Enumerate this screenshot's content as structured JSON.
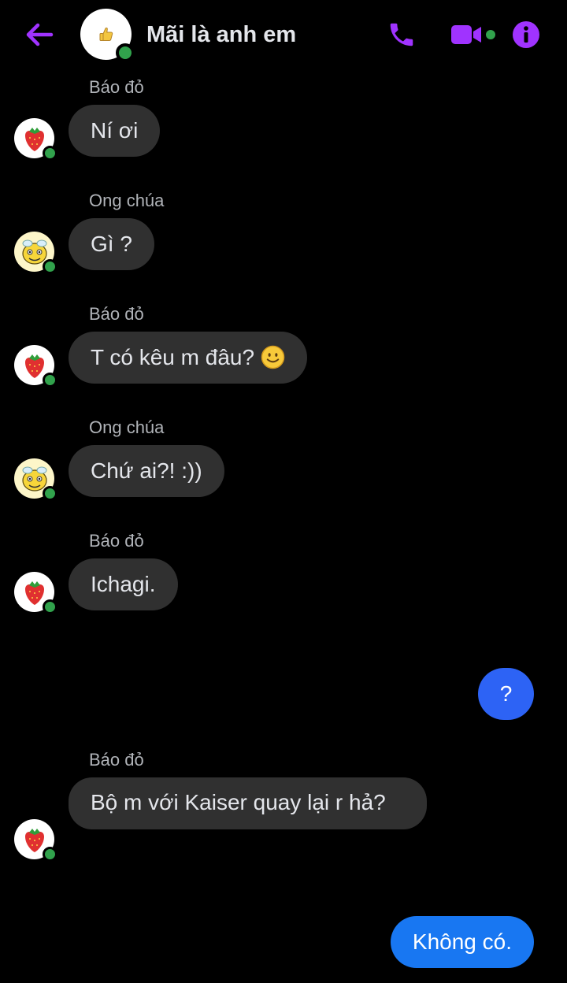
{
  "header": {
    "title": "Mãi là anh em",
    "back_icon": "arrow-left-icon",
    "call_icon": "phone-icon",
    "video_icon": "video-camera-icon",
    "info_icon": "info-icon",
    "accent_color": "#a033ff",
    "online_color": "#31a24c"
  },
  "messages": [
    {
      "sender": "Báo đỏ",
      "text": "Ní ơi",
      "avatar": "strawberry-icon",
      "direction": "incoming"
    },
    {
      "sender": "Ong chúa",
      "text": "Gì ?",
      "avatar": "bee-icon",
      "direction": "incoming"
    },
    {
      "sender": "Báo đỏ",
      "text": "T có kêu m đâu?",
      "emoji": "smile-emoji-icon",
      "avatar": "strawberry-icon",
      "direction": "incoming"
    },
    {
      "sender": "Ong chúa",
      "text": "Chứ ai?! :))",
      "avatar": "bee-icon",
      "direction": "incoming"
    },
    {
      "sender": "Báo đỏ",
      "text": "Ichagi.",
      "avatar": "strawberry-icon",
      "direction": "incoming"
    },
    {
      "text": "?",
      "direction": "outgoing"
    },
    {
      "sender": "Báo đỏ",
      "text": "Bộ m với Kaiser quay lại r hả?",
      "avatar": "strawberry-icon",
      "direction": "incoming"
    },
    {
      "text": "Không có.",
      "direction": "outgoing"
    }
  ],
  "colors": {
    "incoming_bubble": "#303030",
    "outgoing_bubble": "#2d63f5",
    "outgoing_bubble_2": "#1877f2"
  }
}
